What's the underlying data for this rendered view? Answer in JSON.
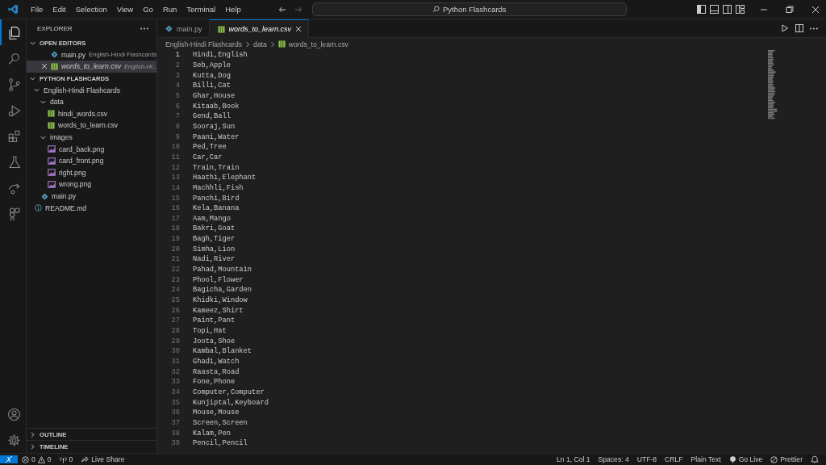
{
  "titlebar": {
    "menu": [
      "File",
      "Edit",
      "Selection",
      "View",
      "Go",
      "Run",
      "Terminal",
      "Help"
    ],
    "search": "Python Flashcards"
  },
  "activity_bar": {
    "items": [
      {
        "kind": "explorer",
        "selected": true
      },
      {
        "kind": "search",
        "selected": false
      },
      {
        "kind": "source-control",
        "selected": false
      },
      {
        "kind": "run",
        "selected": false
      },
      {
        "kind": "extensions",
        "selected": false
      },
      {
        "kind": "testing",
        "selected": false
      },
      {
        "kind": "remote",
        "selected": false
      },
      {
        "kind": "blocks",
        "selected": false
      }
    ]
  },
  "sidebar": {
    "title": "EXPLORER",
    "open_editors": {
      "title": "OPEN EDITORS",
      "expanded": true,
      "items": [
        {
          "name": "main.py",
          "path": "English-Hindi Flashcards",
          "kind": "py",
          "selected": false,
          "preview": false
        },
        {
          "name": "words_to_learn.csv",
          "path": "English-Hi...",
          "kind": "csv",
          "selected": true,
          "preview": true
        }
      ]
    },
    "folder": {
      "title": "PYTHON FLASHCARDS",
      "expanded": true,
      "children": [
        {
          "name": "English-Hindi Flashcards",
          "kind": "folder",
          "expanded": true,
          "children": [
            {
              "name": "data",
              "kind": "folder",
              "expanded": true,
              "children": [
                {
                  "name": "hindi_words.csv",
                  "kind": "csv"
                },
                {
                  "name": "words_to_learn.csv",
                  "kind": "csv"
                }
              ]
            },
            {
              "name": "images",
              "kind": "folder",
              "expanded": true,
              "children": [
                {
                  "name": "card_back.png",
                  "kind": "png"
                },
                {
                  "name": "card_front.png",
                  "kind": "png"
                },
                {
                  "name": "right.png",
                  "kind": "png"
                },
                {
                  "name": "wrong.png",
                  "kind": "png"
                }
              ]
            },
            {
              "name": "main.py",
              "kind": "py"
            }
          ]
        },
        {
          "name": "README.md",
          "kind": "md"
        }
      ]
    },
    "sections": [
      {
        "title": "OUTLINE",
        "expanded": false
      },
      {
        "title": "TIMELINE",
        "expanded": false
      }
    ]
  },
  "tabs": [
    {
      "label": "main.py",
      "kind": "py",
      "selected": false,
      "preview": false
    },
    {
      "label": "words_to_learn.csv",
      "kind": "csv",
      "selected": true,
      "preview": true
    }
  ],
  "breadcrumb": [
    {
      "label": "English-Hindi Flashcards",
      "kind": "folder"
    },
    {
      "label": "data",
      "kind": "folder"
    },
    {
      "label": "words_to_learn.csv",
      "kind": "csv"
    }
  ],
  "editor": {
    "lines": [
      {
        "number": "1",
        "text": "Hindi,English",
        "current": true
      },
      {
        "number": "2",
        "text": "Seb,Apple",
        "current": false
      },
      {
        "number": "3",
        "text": "Kutta,Dog",
        "current": false
      },
      {
        "number": "4",
        "text": "Billi,Cat",
        "current": false
      },
      {
        "number": "5",
        "text": "Ghar,House",
        "current": false
      },
      {
        "number": "6",
        "text": "Kitaab,Book",
        "current": false
      },
      {
        "number": "7",
        "text": "Gend,Ball",
        "current": false
      },
      {
        "number": "8",
        "text": "Sooraj,Sun",
        "current": false
      },
      {
        "number": "9",
        "text": "Paani,Water",
        "current": false
      },
      {
        "number": "10",
        "text": "Ped,Tree",
        "current": false
      },
      {
        "number": "11",
        "text": "Car,Car",
        "current": false
      },
      {
        "number": "12",
        "text": "Train,Train",
        "current": false
      },
      {
        "number": "13",
        "text": "Haathi,Elephant",
        "current": false
      },
      {
        "number": "14",
        "text": "Machhli,Fish",
        "current": false
      },
      {
        "number": "15",
        "text": "Panchi,Bird",
        "current": false
      },
      {
        "number": "16",
        "text": "Kela,Banana",
        "current": false
      },
      {
        "number": "17",
        "text": "Aam,Mango",
        "current": false
      },
      {
        "number": "18",
        "text": "Bakri,Goat",
        "current": false
      },
      {
        "number": "19",
        "text": "Bagh,Tiger",
        "current": false
      },
      {
        "number": "20",
        "text": "Simha,Lion",
        "current": false
      },
      {
        "number": "21",
        "text": "Nadi,River",
        "current": false
      },
      {
        "number": "22",
        "text": "Pahad,Mountain",
        "current": false
      },
      {
        "number": "23",
        "text": "Phool,Flower",
        "current": false
      },
      {
        "number": "24",
        "text": "Bagicha,Garden",
        "current": false
      },
      {
        "number": "25",
        "text": "Khidki,Window",
        "current": false
      },
      {
        "number": "26",
        "text": "Kameez,Shirt",
        "current": false
      },
      {
        "number": "27",
        "text": "Paint,Pant",
        "current": false
      },
      {
        "number": "28",
        "text": "Topi,Hat",
        "current": false
      },
      {
        "number": "29",
        "text": "Joota,Shoe",
        "current": false
      },
      {
        "number": "30",
        "text": "Kambal,Blanket",
        "current": false
      },
      {
        "number": "31",
        "text": "Ghadi,Watch",
        "current": false
      },
      {
        "number": "32",
        "text": "Raasta,Road",
        "current": false
      },
      {
        "number": "33",
        "text": "Fone,Phone",
        "current": false
      },
      {
        "number": "34",
        "text": "Computer,Computer",
        "current": false
      },
      {
        "number": "35",
        "text": "Kunjiptal,Keyboard",
        "current": false
      },
      {
        "number": "36",
        "text": "Mouse,Mouse",
        "current": false
      },
      {
        "number": "37",
        "text": "Screen,Screen",
        "current": false
      },
      {
        "number": "38",
        "text": "Kalam,Pen",
        "current": false
      },
      {
        "number": "39",
        "text": "Pencil,Pencil",
        "current": false
      }
    ]
  },
  "status_bar": {
    "left": [
      {
        "kind": "remote"
      },
      {
        "kind": "problems",
        "errors": "0",
        "warnings": "0"
      },
      {
        "kind": "ports",
        "text": "0"
      },
      {
        "kind": "liveshare",
        "text": "Live Share"
      }
    ],
    "right": [
      {
        "kind": "text",
        "text": "Ln 1, Col 1"
      },
      {
        "kind": "text",
        "text": "Spaces: 4"
      },
      {
        "kind": "text",
        "text": "UTF-8"
      },
      {
        "kind": "text",
        "text": "CRLF"
      },
      {
        "kind": "text",
        "text": "Plain Text"
      },
      {
        "kind": "golive",
        "text": "Go Live"
      },
      {
        "kind": "prettier",
        "text": "Prettier"
      },
      {
        "kind": "bell"
      }
    ]
  }
}
